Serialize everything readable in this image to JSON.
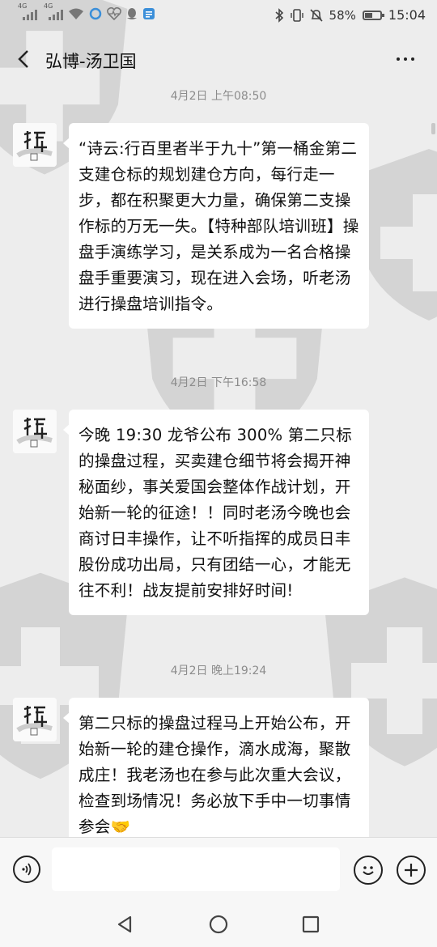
{
  "status_bar": {
    "signal1_label": "4G",
    "signal2_label": "4G",
    "battery_percent": 58,
    "battery_text": "58%",
    "time": "15:04"
  },
  "header": {
    "title": "弘博-汤卫国"
  },
  "messages": [
    {
      "timestamp": "4月2日 上午08:50",
      "text": "“诗云:行百里者半于九十”第一桶金第二支建仓标的规划建仓方向，每行走一步，都在积聚更大力量，确保第二支操作标的万无一失。【特种部队培训班】操盘手演练学习，是关系成为一名合格操盘手重要演习，现在进入会场，听老汤进行操盘培训指令。"
    },
    {
      "timestamp": "4月2日 下午16:58",
      "text": "今晚 19:30 龙爷公布 300% 第二只标的操盘过程，买卖建仓细节将会揭开神秘面纱，事关爱国会整体作战计划，开始新一轮的征途！！同时老汤今晚也会商讨日丰操作，让不听指挥的成员日丰股份成功出局，只有团结一心，才能无往不利！战友提前安排好时间!"
    },
    {
      "timestamp": "4月2日 晚上19:24",
      "text": "第二只标的操盘过程马上开始公布，开始新一轮的建仓操作，滴水成海，聚散成庄！我老汤也在参与此次重大会议，检查到场情况！务必放下手中一切事情参会🤝"
    }
  ],
  "input": {
    "value": "",
    "placeholder": ""
  },
  "icons": {
    "back": "chevron-left-icon",
    "more": "more-dots-icon",
    "voice": "voice-icon",
    "emoji": "emoji-icon",
    "plus": "plus-icon",
    "nav_back": "triangle-back-icon",
    "nav_home": "circle-home-icon",
    "nav_recent": "square-recent-icon"
  }
}
